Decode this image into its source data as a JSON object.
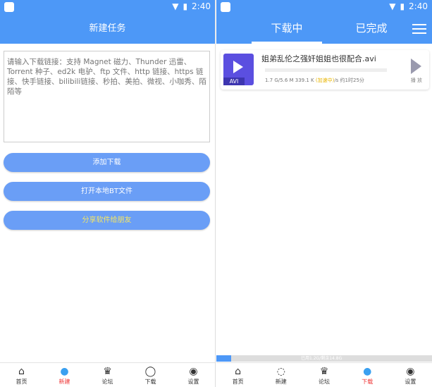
{
  "status": {
    "time": "2:40"
  },
  "left": {
    "title": "新建任务",
    "input_placeholder": "请输入下载链接：支持 Magnet 磁力、Thunder 迅雷、Torrent 种子、ed2k 电驴、ftp 文件、http 链接、https 链接、快手链接、bilibili链接、秒拍、美拍、微视、小咖秀、陌陌等",
    "buttons": [
      "添加下载",
      "打开本地BT文件",
      "分享软件给朋友"
    ],
    "accent_text_color": "#f5e663"
  },
  "right": {
    "tabs": [
      "下载中",
      "已完成"
    ],
    "task": {
      "thumb_label": "AVI",
      "name": "姐弟乱伦之强奸姐姐也很配合.avi",
      "size": "1.7 G/5.6 M 339.1 K",
      "accel": "(加速中)",
      "rest": "/s 约1时25分",
      "play_label": "播 放",
      "progress": 0
    },
    "storage": {
      "text": "已用1.2G/剩余14.8G",
      "used_fraction": 0.07
    }
  },
  "nav": {
    "items": [
      "首页",
      "新建",
      "论坛",
      "下载",
      "设置"
    ]
  },
  "colors": {
    "primary": "#4d98f7",
    "active": "#e33333"
  }
}
